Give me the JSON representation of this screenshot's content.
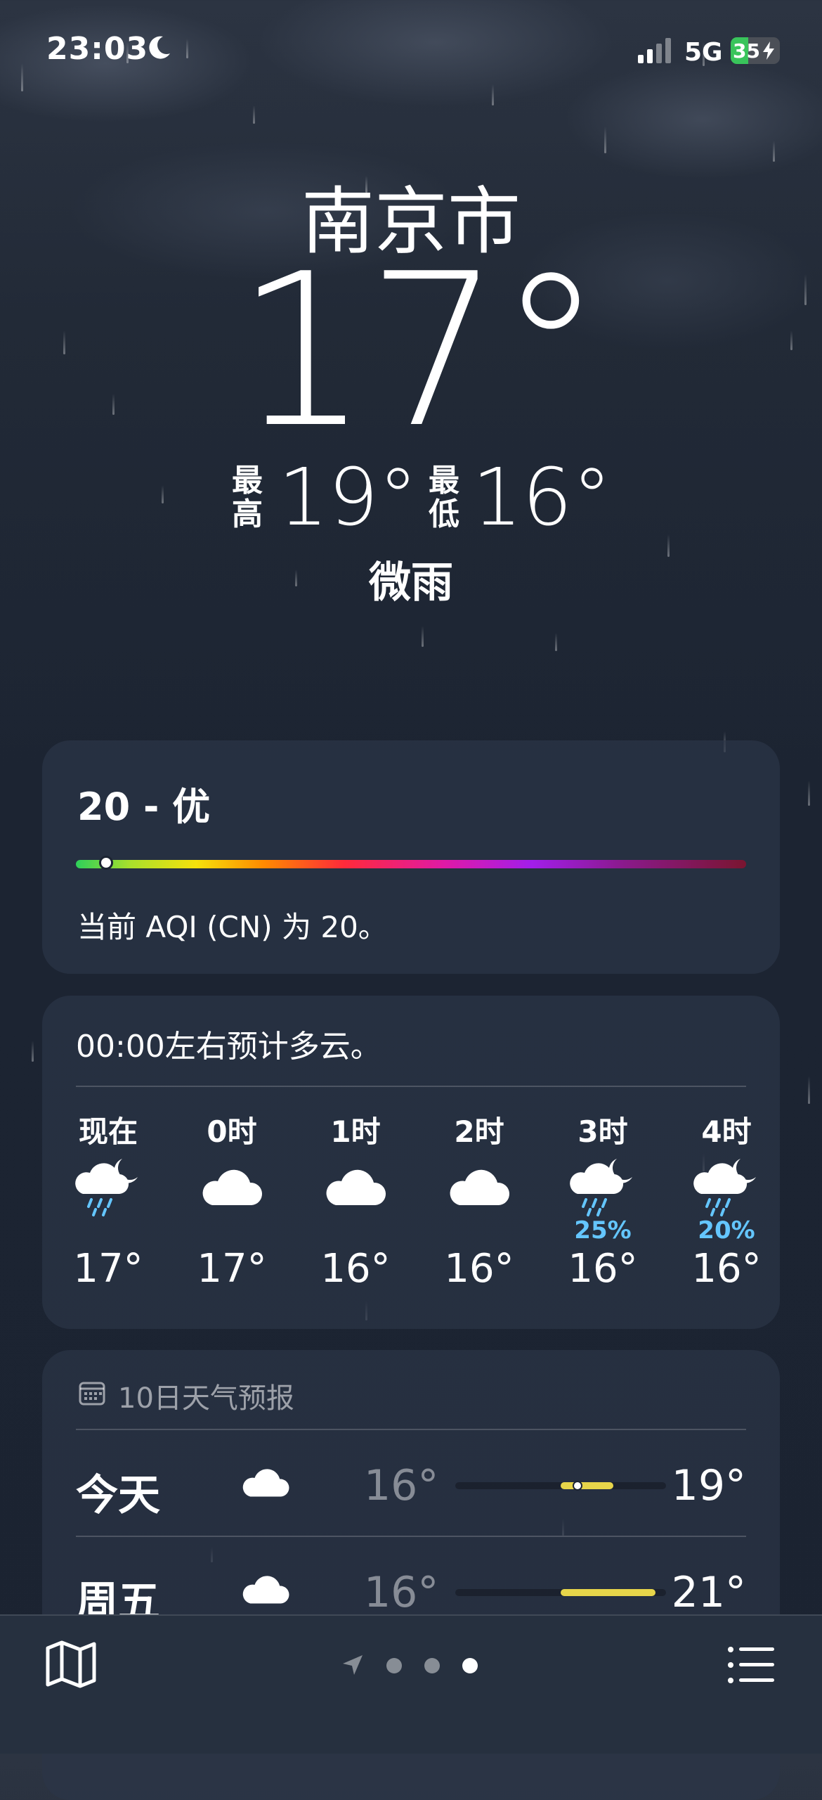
{
  "status_bar": {
    "time": "23:03",
    "network": "5G",
    "battery_percent": 35,
    "battery_label": "35"
  },
  "location": {
    "city": "南京市",
    "current_temp": "17°",
    "high_label": "最高",
    "high": "19°",
    "low_label": "最低",
    "low": "16°",
    "condition": "微雨"
  },
  "aqi": {
    "title": "20 - 优",
    "description": "当前 AQI (CN) 为 20。",
    "value_fraction": 0.045
  },
  "hourly": {
    "summary": "00:00左右预计多云。",
    "items": [
      {
        "label": "现在",
        "icon": "moon-cloud-rain-icon",
        "prob": "",
        "temp": "17°"
      },
      {
        "label": "0时",
        "icon": "cloud-icon",
        "prob": "",
        "temp": "17°"
      },
      {
        "label": "1时",
        "icon": "cloud-icon",
        "prob": "",
        "temp": "16°"
      },
      {
        "label": "2时",
        "icon": "cloud-icon",
        "prob": "",
        "temp": "16°"
      },
      {
        "label": "3时",
        "icon": "moon-cloud-rain-icon",
        "prob": "25%",
        "temp": "16°"
      },
      {
        "label": "4时",
        "icon": "moon-cloud-rain-icon",
        "prob": "20%",
        "temp": "16°"
      }
    ]
  },
  "daily": {
    "header": "10日天气预报",
    "days": [
      {
        "name": "今天",
        "icon": "cloud-icon",
        "low": "16°",
        "high": "19°",
        "range_start": 0.5,
        "range_end": 0.75,
        "now_pos": 0.58
      },
      {
        "name": "周五",
        "icon": "cloud-icon",
        "low": "16°",
        "high": "21°",
        "range_start": 0.5,
        "range_end": 0.95
      }
    ]
  },
  "pager": {
    "page_count": 3,
    "active_page": 3
  },
  "colors": {
    "aqi_good": "#2ed05a",
    "precip_blue": "#64c6ff",
    "temp_range": "#e7d54a",
    "battery_green": "#39c45b"
  }
}
